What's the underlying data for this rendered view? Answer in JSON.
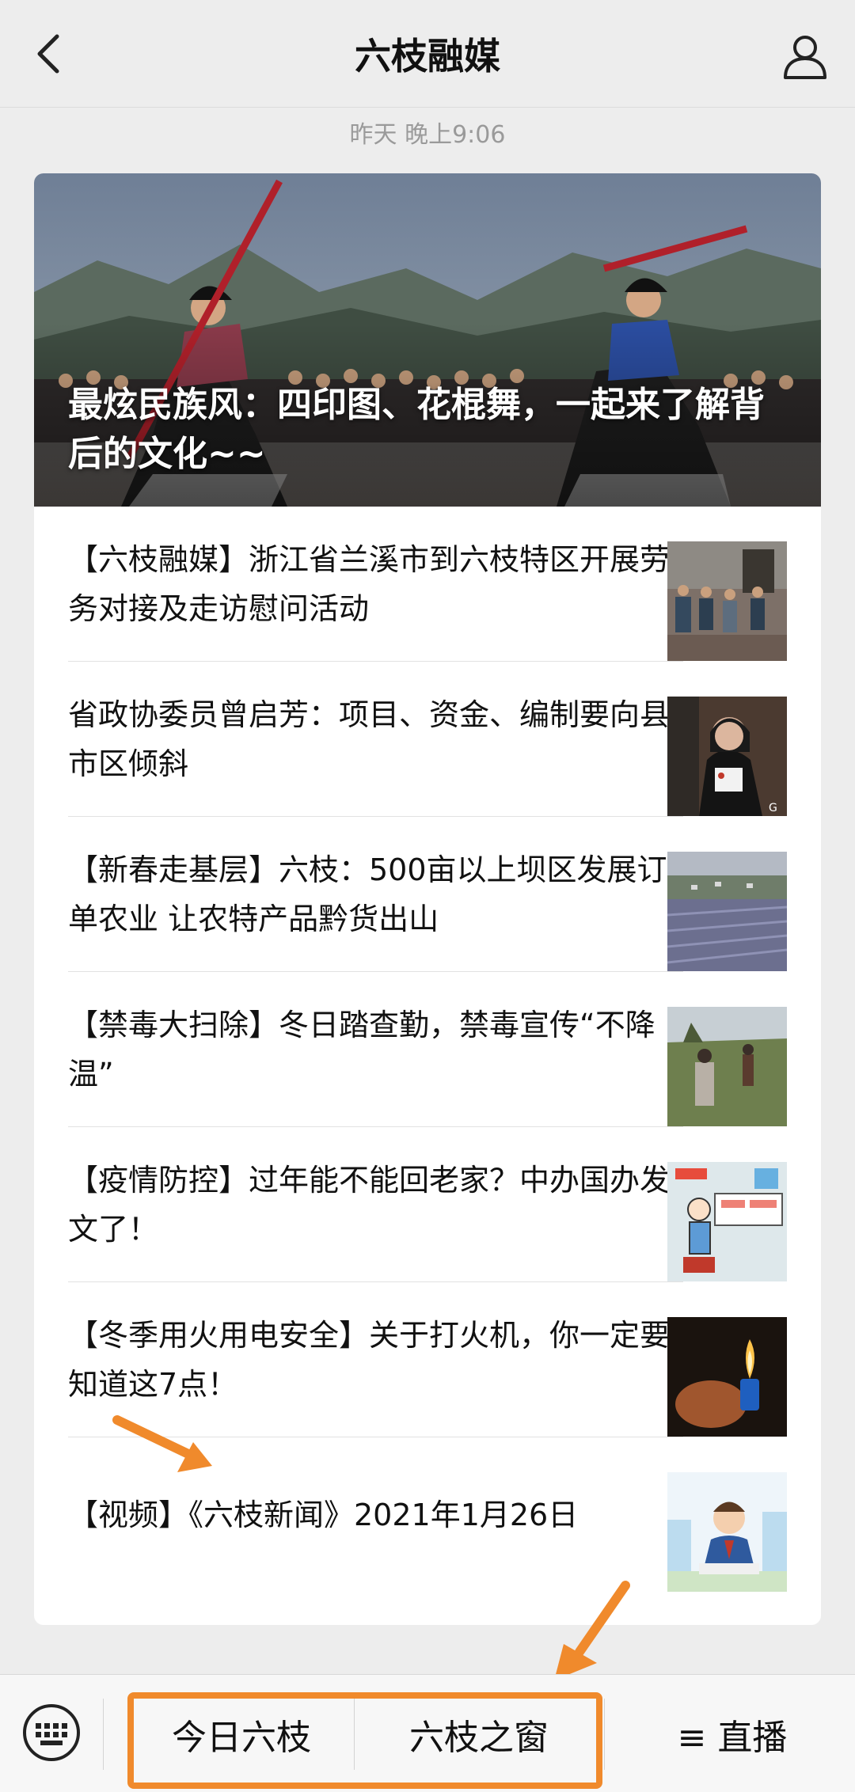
{
  "header": {
    "title": "六枝融媒"
  },
  "timestamp": "昨天 晚上9:06",
  "hero": {
    "title": "最炫民族风：四印图、花棍舞，一起来了解背后的文化~~"
  },
  "articles": [
    {
      "title": "【六枝融媒】浙江省兰溪市到六枝特区开展劳务对接及走访慰问活动"
    },
    {
      "title": "省政协委员曾启芳：项目、资金、编制要向县市区倾斜"
    },
    {
      "title": "【新春走基层】六枝：500亩以上坝区发展订单农业 让农特产品黔货出山"
    },
    {
      "title": "【禁毒大扫除】冬日踏查勤，禁毒宣传“不降温”"
    },
    {
      "title": "【疫情防控】过年能不能回老家？中办国办发文了！"
    },
    {
      "title": "【冬季用火用电安全】关于打火机，你一定要知道这7点！"
    },
    {
      "title": "【视频】《六枝新闻》2021年1月26日"
    }
  ],
  "bottom_menu": {
    "item1": "今日六枝",
    "item2": "六枝之窗",
    "item3": "≡ 直播"
  },
  "colors": {
    "accent_orange": "#f08a2c",
    "background": "#ededed"
  },
  "icons": {
    "back": "chevron-left-icon",
    "profile": "person-icon",
    "keyboard": "keyboard-icon"
  }
}
